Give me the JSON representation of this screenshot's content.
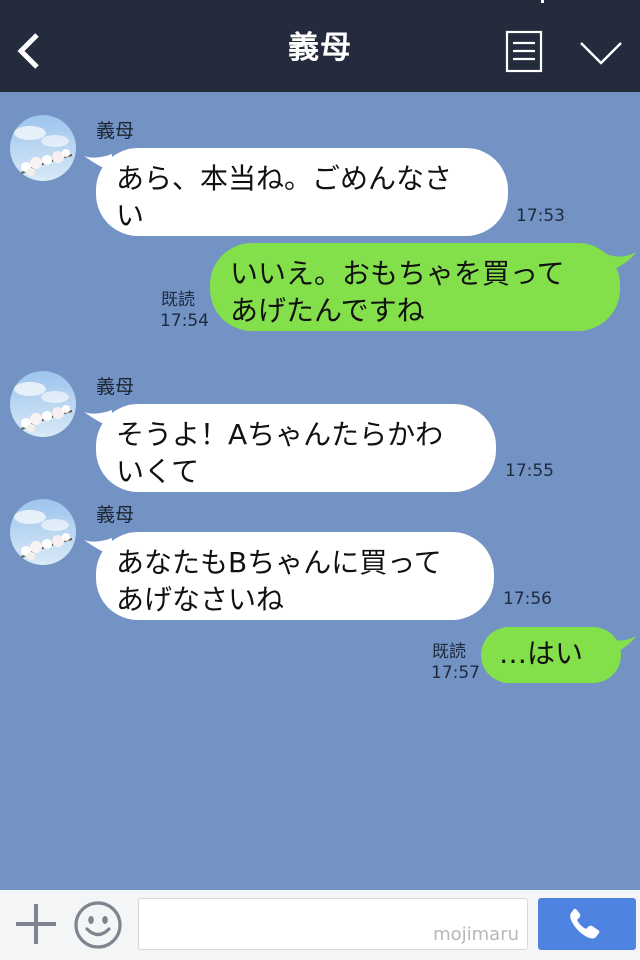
{
  "header": {
    "title": "義母"
  },
  "messages": [
    {
      "sender": "義母",
      "lines": [
        "あら、本当ね。ごめんなさ",
        "い"
      ],
      "time": "17:53"
    },
    {
      "lines": [
        "いいえ。おもちゃを買って",
        "あげたんですね"
      ],
      "read": "既読",
      "time": "17:54"
    },
    {
      "sender": "義母",
      "lines": [
        "そうよ！Aちゃんたらかわ",
        "いくて"
      ],
      "time": "17:55"
    },
    {
      "sender": "義母",
      "lines": [
        "あなたもBちゃんに買って",
        "あげなさいね"
      ],
      "time": "17:56"
    },
    {
      "lines": [
        "…はい"
      ],
      "read": "既読",
      "time": "17:57"
    }
  ],
  "footer": {
    "watermark": "mojimaru"
  },
  "icons": {
    "back": "chevron-left-icon",
    "menu": "menu-icon",
    "collapse": "chevron-down-icon",
    "add": "plus-icon",
    "emoji": "smiley-icon",
    "call": "phone-icon"
  },
  "colors": {
    "background": "#7393c4",
    "header": "#232b3d",
    "incoming_bubble": "#ffffff",
    "outgoing_bubble": "#84e04a",
    "call_button": "#4f83e2"
  }
}
